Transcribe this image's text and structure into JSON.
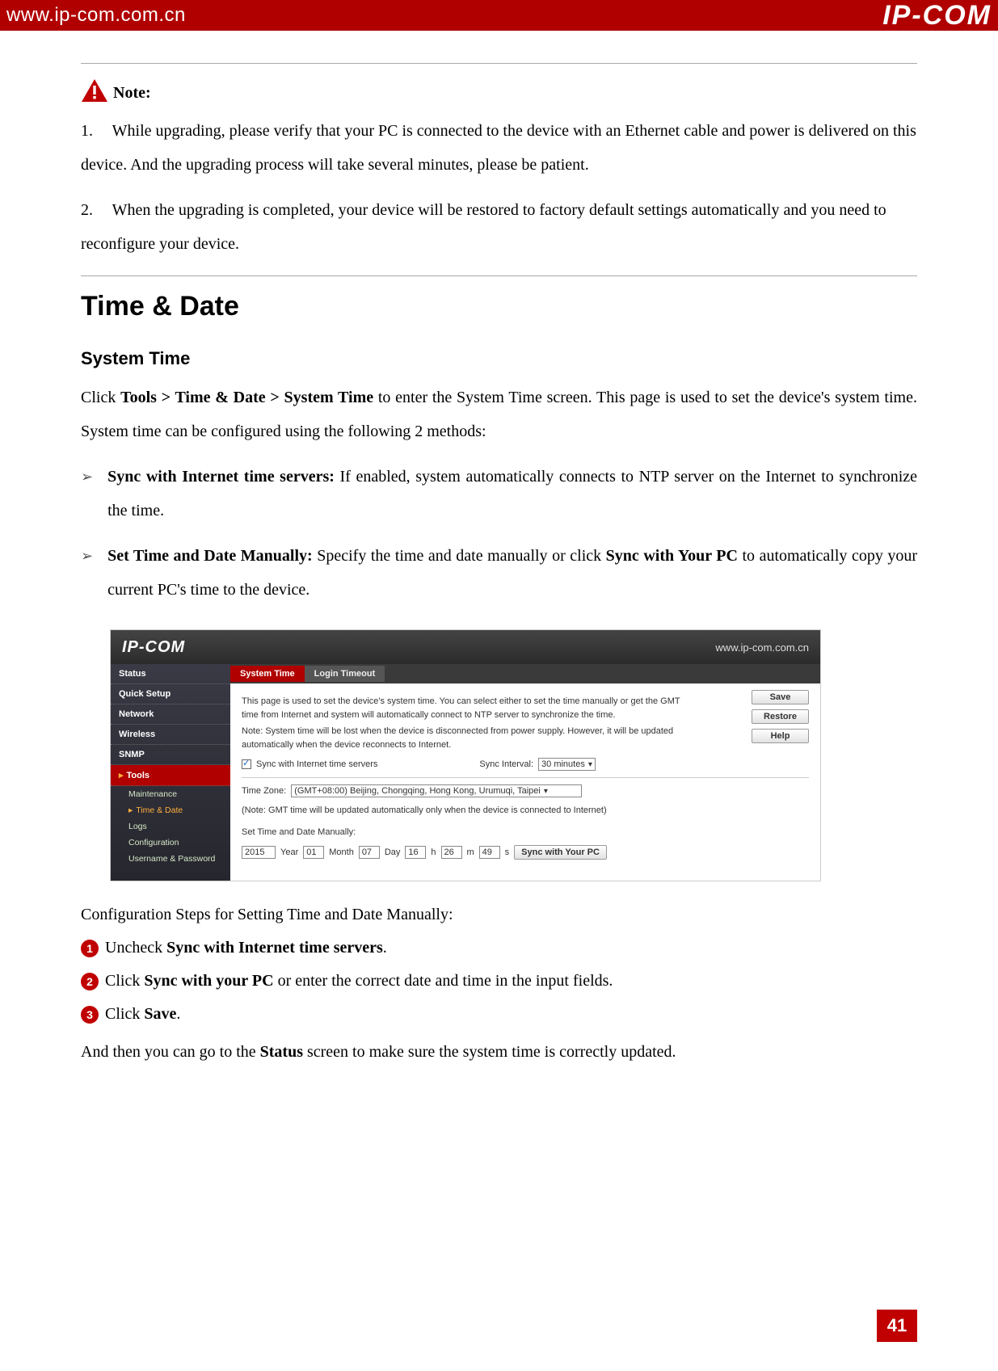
{
  "header": {
    "url": "www.ip-com.com.cn",
    "logo": "IP-COM"
  },
  "note": {
    "label": "Note:",
    "item1_num": "1.",
    "item1_text": "While upgrading, please verify that your PC is connected to the device with an Ethernet cable and power is delivered on this device. And the upgrading process will take several minutes, please be patient.",
    "item2_num": "2.",
    "item2_text": "When the upgrading is completed, your device will be restored to factory default settings automatically and you need to reconfigure your device."
  },
  "section": {
    "h1": "Time & Date",
    "h2": "System Time",
    "intro_pre": "Click ",
    "intro_bold": "Tools > Time & Date > System Time",
    "intro_post": " to enter the System Time screen. This page is used to set the device's system time. System time can be configured using the following 2 methods:",
    "b1_bold": "Sync with Internet time servers:",
    "b1_text": " If enabled, system automatically connects to NTP server on the Internet to synchronize the time.",
    "b2_bold": "Set Time and Date Manually:",
    "b2_mid": " Specify the time and date manually or click ",
    "b2_bold2": "Sync with Your PC",
    "b2_post": " to automatically copy your current PC's time to the device."
  },
  "screenshot": {
    "logo": "IP-COM",
    "url": "www.ip-com.com.cn",
    "tab_active": "System Time",
    "tab_other": "Login Timeout",
    "side": {
      "status": "Status",
      "quick": "Quick Setup",
      "network": "Network",
      "wireless": "Wireless",
      "snmp": "SNMP",
      "tools": "Tools",
      "maint": "Maintenance",
      "timedate": "Time & Date",
      "logs": "Logs",
      "config": "Configuration",
      "userpass": "Username & Password"
    },
    "btns": {
      "save": "Save",
      "restore": "Restore",
      "help": "Help"
    },
    "desc1": "This page is used to set the device's system time. You can select either to set the time manually or get the GMT time from Internet and system will automatically connect to NTP server to synchronize the time.",
    "desc2": "Note: System time will be lost when the device is disconnected from power supply. However, it will be updated automatically when the device reconnects to Internet.",
    "sync_label": "Sync with Internet time servers",
    "interval_label": "Sync Interval:",
    "interval_value": "30 minutes",
    "tz_label": "Time Zone:",
    "tz_value": "(GMT+08:00) Beijing, Chongqing, Hong Kong, Urumuqi, Taipei",
    "tz_note": "(Note: GMT time will be updated automatically only when the device is connected to Internet)",
    "set_label": "Set Time and Date Manually:",
    "year": "2015",
    "year_l": "Year",
    "month": "01",
    "month_l": "Month",
    "day": "07",
    "day_l": "Day",
    "hour": "16",
    "hour_l": "h",
    "min": "26",
    "min_l": "m",
    "sec": "49",
    "sec_l": "s",
    "syncpc": "Sync with Your PC"
  },
  "steps": {
    "heading": "Configuration Steps for Setting Time and Date Manually:",
    "s1_pre": "Uncheck ",
    "s1_bold": "Sync with Internet time servers",
    "s1_post": ".",
    "s2_pre": "Click ",
    "s2_bold": "Sync with your PC",
    "s2_post": " or enter the correct date and time in the input fields.",
    "s3_pre": "Click ",
    "s3_bold": "Save",
    "s3_post": ".",
    "after_pre": "And then you can go to the ",
    "after_bold": "Status",
    "after_post": " screen to make sure the system time is correctly updated."
  },
  "page_number": "41"
}
